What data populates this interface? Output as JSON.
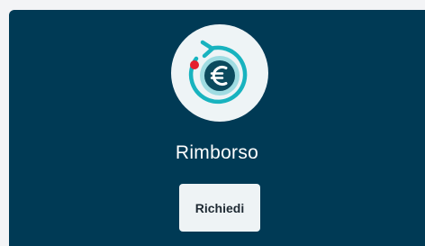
{
  "card": {
    "title": "Rimborso",
    "button_label": "Richiedi",
    "icon": "euro-refund-icon",
    "notification_dot": true
  },
  "colors": {
    "card_background": "#003a55",
    "icon_background": "#eef4f6",
    "icon_teal": "#18b3bf",
    "icon_dark": "#0b4a5e",
    "notification_red": "#e5202e",
    "button_background": "#eef3f5",
    "title_text": "#ffffff"
  }
}
